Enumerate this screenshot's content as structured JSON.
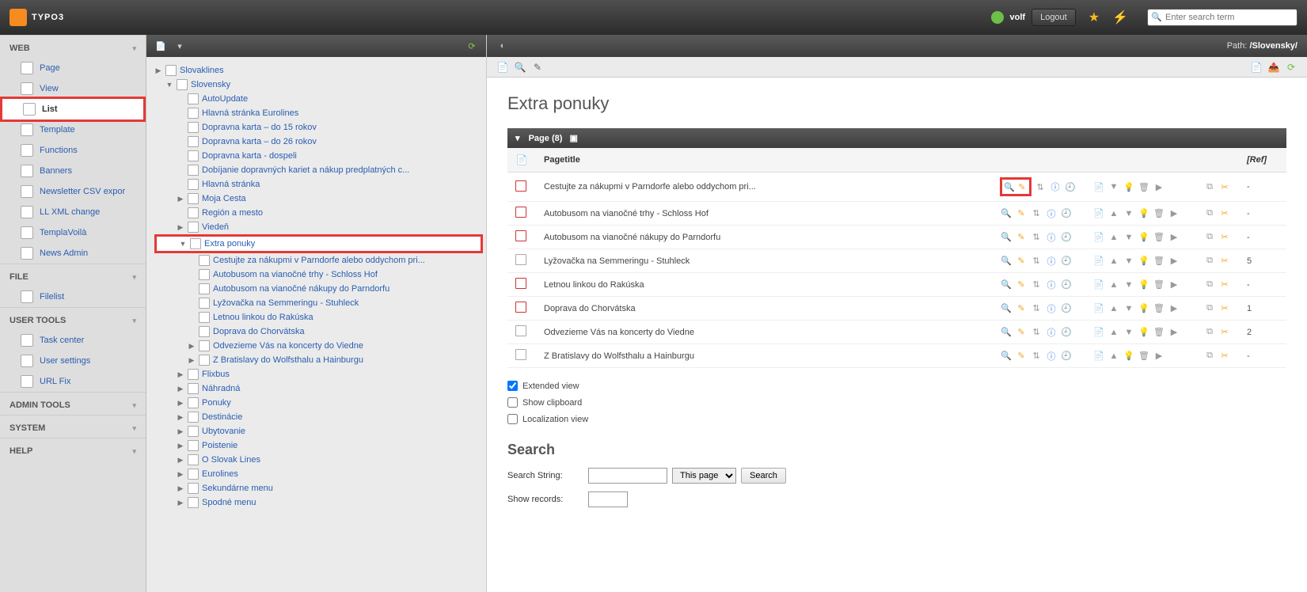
{
  "app": {
    "name": "TYPO3",
    "username": "volf",
    "logout": "Logout",
    "search_placeholder": "Enter search term"
  },
  "path": {
    "label": "Path:",
    "value": "/Slovensky/"
  },
  "modules": {
    "groups": [
      {
        "title": "WEB",
        "items": [
          {
            "label": "Page"
          },
          {
            "label": "View"
          },
          {
            "label": "List",
            "selected": true,
            "highlight": true
          },
          {
            "label": "Template"
          },
          {
            "label": "Functions"
          },
          {
            "label": "Banners"
          },
          {
            "label": "Newsletter CSV expor"
          },
          {
            "label": "LL XML change"
          },
          {
            "label": "TemplaVoilà"
          },
          {
            "label": "News Admin"
          }
        ]
      },
      {
        "title": "FILE",
        "items": [
          {
            "label": "Filelist"
          }
        ]
      },
      {
        "title": "USER TOOLS",
        "items": [
          {
            "label": "Task center"
          },
          {
            "label": "User settings"
          },
          {
            "label": "URL Fix"
          }
        ]
      },
      {
        "title": "ADMIN TOOLS",
        "items": []
      },
      {
        "title": "SYSTEM",
        "items": []
      },
      {
        "title": "HELP",
        "items": []
      }
    ]
  },
  "tree": {
    "root": "Slovaklines",
    "l2": [
      {
        "label": "Slovensky",
        "expanded": true,
        "children": [
          {
            "label": "AutoUpdate"
          },
          {
            "label": "Hlavná stránka Eurolines"
          },
          {
            "label": "Dopravna karta – do 15 rokov"
          },
          {
            "label": "Dopravna karta – do 26 rokov"
          },
          {
            "label": "Dopravna karta - dospeli"
          },
          {
            "label": "Dobíjanie dopravných kariet a nákup predplatných c..."
          },
          {
            "label": "Hlavná stránka"
          },
          {
            "label": "Moja Cesta",
            "hasChildren": true
          },
          {
            "label": "Región a mesto"
          },
          {
            "label": "Viedeň",
            "hasChildren": true
          },
          {
            "label": "Extra ponuky",
            "hasChildren": true,
            "expanded": true,
            "selected": true,
            "highlight": true,
            "children": [
              {
                "label": "Cestujte za nákupmi v Parndorfe alebo oddychom pri..."
              },
              {
                "label": "Autobusom na vianočné trhy - Schloss Hof"
              },
              {
                "label": "Autobusom na vianočné nákupy do Parndorfu"
              },
              {
                "label": "Lyžovačka na Semmeringu - Stuhleck"
              },
              {
                "label": "Letnou linkou do Rakúska"
              },
              {
                "label": "Doprava do Chorvátska"
              },
              {
                "label": "Odvezieme Vás na koncerty do Viedne",
                "hasChildren": true
              },
              {
                "label": "Z Bratislavy do Wolfsthalu a Hainburgu",
                "hasChildren": true
              }
            ]
          },
          {
            "label": "Flixbus",
            "hasChildren": true
          },
          {
            "label": "Náhradná",
            "hasChildren": true
          },
          {
            "label": "Ponuky",
            "hasChildren": true
          },
          {
            "label": "Destinácie",
            "hasChildren": true
          },
          {
            "label": "Ubytovanie",
            "hasChildren": true
          },
          {
            "label": "Poistenie",
            "hasChildren": true
          },
          {
            "label": "O Slovak Lines",
            "hasChildren": true
          },
          {
            "label": "Eurolines",
            "hasChildren": true
          },
          {
            "label": "Sekundárne menu",
            "hasChildren": true
          },
          {
            "label": "Spodné menu",
            "hasChildren": true
          }
        ]
      }
    ]
  },
  "main": {
    "title": "Extra ponuky",
    "table": {
      "header": "Page (8)",
      "col_title": "Pagetitle",
      "col_ref": "[Ref]",
      "rows": [
        {
          "title": "Cestujte za nákupmi v Parndorfe alebo oddychom pri...",
          "ref": "-",
          "hidden": true,
          "highlight_edit": true,
          "first": true
        },
        {
          "title": "Autobusom na vianočné trhy - Schloss Hof",
          "ref": "-",
          "hidden": true
        },
        {
          "title": "Autobusom na vianočné nákupy do Parndorfu",
          "ref": "-",
          "hidden": true
        },
        {
          "title": "Lyžovačka na Semmeringu - Stuhleck",
          "ref": "5"
        },
        {
          "title": "Letnou linkou do Rakúska",
          "ref": "-",
          "hidden": true
        },
        {
          "title": "Doprava do Chorvátska",
          "ref": "1",
          "hidden": true
        },
        {
          "title": "Odvezieme Vás na koncerty do Viedne",
          "ref": "2"
        },
        {
          "title": "Z Bratislavy do Wolfsthalu a Hainburgu",
          "ref": "-",
          "last": true
        }
      ]
    },
    "options": {
      "extended": {
        "label": "Extended view",
        "checked": true
      },
      "clipboard": {
        "label": "Show clipboard",
        "checked": false
      },
      "localization": {
        "label": "Localization view",
        "checked": false
      }
    },
    "search": {
      "heading": "Search",
      "string_label": "Search String:",
      "show_records_label": "Show records:",
      "scope": "This page",
      "button": "Search"
    }
  }
}
